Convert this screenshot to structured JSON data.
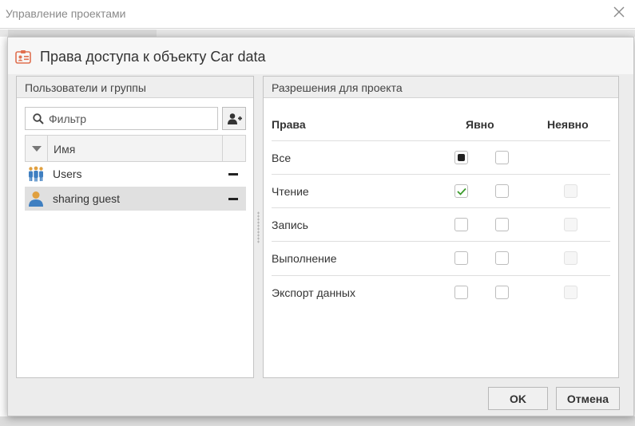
{
  "app": {
    "window_title": "Управление проектами"
  },
  "dialog": {
    "title": "Права доступа к объекту Car data"
  },
  "users_panel": {
    "header": "Пользователи и группы",
    "filter": {
      "placeholder": "Фильтр",
      "value": ""
    },
    "column_name": "Имя",
    "items": [
      {
        "label": "Users",
        "icon": "user-group-icon",
        "selected": false
      },
      {
        "label": "sharing guest",
        "icon": "user-icon",
        "selected": true
      }
    ]
  },
  "permissions_panel": {
    "header": "Разрешения для проекта",
    "columns": {
      "rights": "Права",
      "explicit": "Явно",
      "implicit": "Неявно"
    },
    "rows": [
      {
        "label": "Все",
        "allow": "indeterminate",
        "deny": "unchecked",
        "implicit": "none"
      },
      {
        "label": "Чтение",
        "allow": "checked",
        "deny": "unchecked",
        "implicit": "disabled"
      },
      {
        "label": "Запись",
        "allow": "unchecked",
        "deny": "unchecked",
        "implicit": "disabled"
      },
      {
        "label": "Выполнение",
        "allow": "unchecked",
        "deny": "unchecked",
        "implicit": "disabled"
      },
      {
        "label": "Экспорт данных",
        "allow": "unchecked",
        "deny": "unchecked",
        "implicit": "disabled"
      }
    ]
  },
  "buttons": {
    "ok": "OK",
    "cancel": "Отмена"
  },
  "colors": {
    "check_green": "#3a9a2a",
    "user_icon_blue": "#3f7fc1",
    "user_icon_orange": "#e0a040",
    "dialog_icon": "#e07050"
  }
}
